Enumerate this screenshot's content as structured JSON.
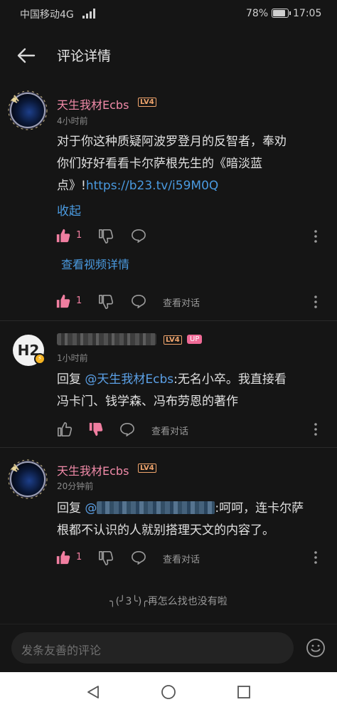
{
  "status": {
    "carrier": "中国移动4G",
    "net": "4G",
    "battery": "78%",
    "battery_level": 0.78,
    "time": "17:05"
  },
  "header": {
    "title": "评论详情"
  },
  "colors": {
    "accent_pink": "#f07ea0",
    "link_blue": "#4a9ae0",
    "username_pink": "#f08aa8",
    "level_orange": "#f0a56d"
  },
  "main_comment": {
    "username": "天生我材Ecbs",
    "level": "LV4",
    "time": "4小时前",
    "text_line1": "对于你这种质疑阿波罗登月的反智者，奉劝",
    "text_line2": "你们好好看看卡尔萨根先生的《暗淡蓝",
    "text_line3_pre": "点》!",
    "text_link": "https://b23.tv/i59M0Q",
    "collapse": "收起",
    "likes": "1",
    "video_link": "查看视频详情"
  },
  "main_actions2": {
    "likes": "1",
    "view_conversation": "查看对话"
  },
  "reply1": {
    "level": "LV4",
    "up": "UP",
    "avatar_text": "H2",
    "time": "1小时前",
    "prefix": "回复 ",
    "mention": "@天生我材Ecbs",
    "text_line1": ":无名小卒。我直接看",
    "text_line2": "冯卡门、钱学森、冯布劳恩的著作",
    "view_conversation": "查看对话"
  },
  "reply2": {
    "username": "天生我材Ecbs",
    "level": "LV4",
    "time": "20分钟前",
    "prefix": "回复 ",
    "mention": "@",
    "text_line1": ":呵呵，连卡尔萨",
    "text_line2": "根都不认识的人就别搭理天文的内容了。",
    "likes": "1",
    "view_conversation": "查看对话"
  },
  "footer": {
    "end_face": "╮(╯3╰)╭",
    "end_text": "再怎么找也没有啦"
  },
  "input": {
    "placeholder": "发条友善的评论"
  }
}
